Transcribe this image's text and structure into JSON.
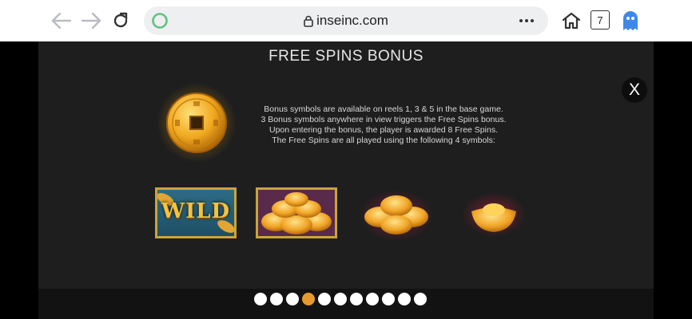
{
  "browser": {
    "url": "inseinc.com",
    "tab_count": "7"
  },
  "game": {
    "title": "FREE SPINS BONUS",
    "close_label": "X",
    "info_lines": [
      "Bonus symbols are available on reels 1, 3 & 5 in the base game.",
      "3 Bonus symbols anywhere in view triggers the Free Spins bonus.",
      "Upon entering the bonus, the player is awarded 8 Free Spins.",
      "The Free Spins are all played using the following 4 symbols:"
    ],
    "symbols": {
      "wild_label": "WILD"
    },
    "pagination": {
      "total_pages": 11,
      "current_page": 4
    }
  },
  "colors": {
    "accent_gold": "#c9a53a",
    "active_dot": "#e89a2e",
    "panel_bg": "#1e1e1e"
  }
}
